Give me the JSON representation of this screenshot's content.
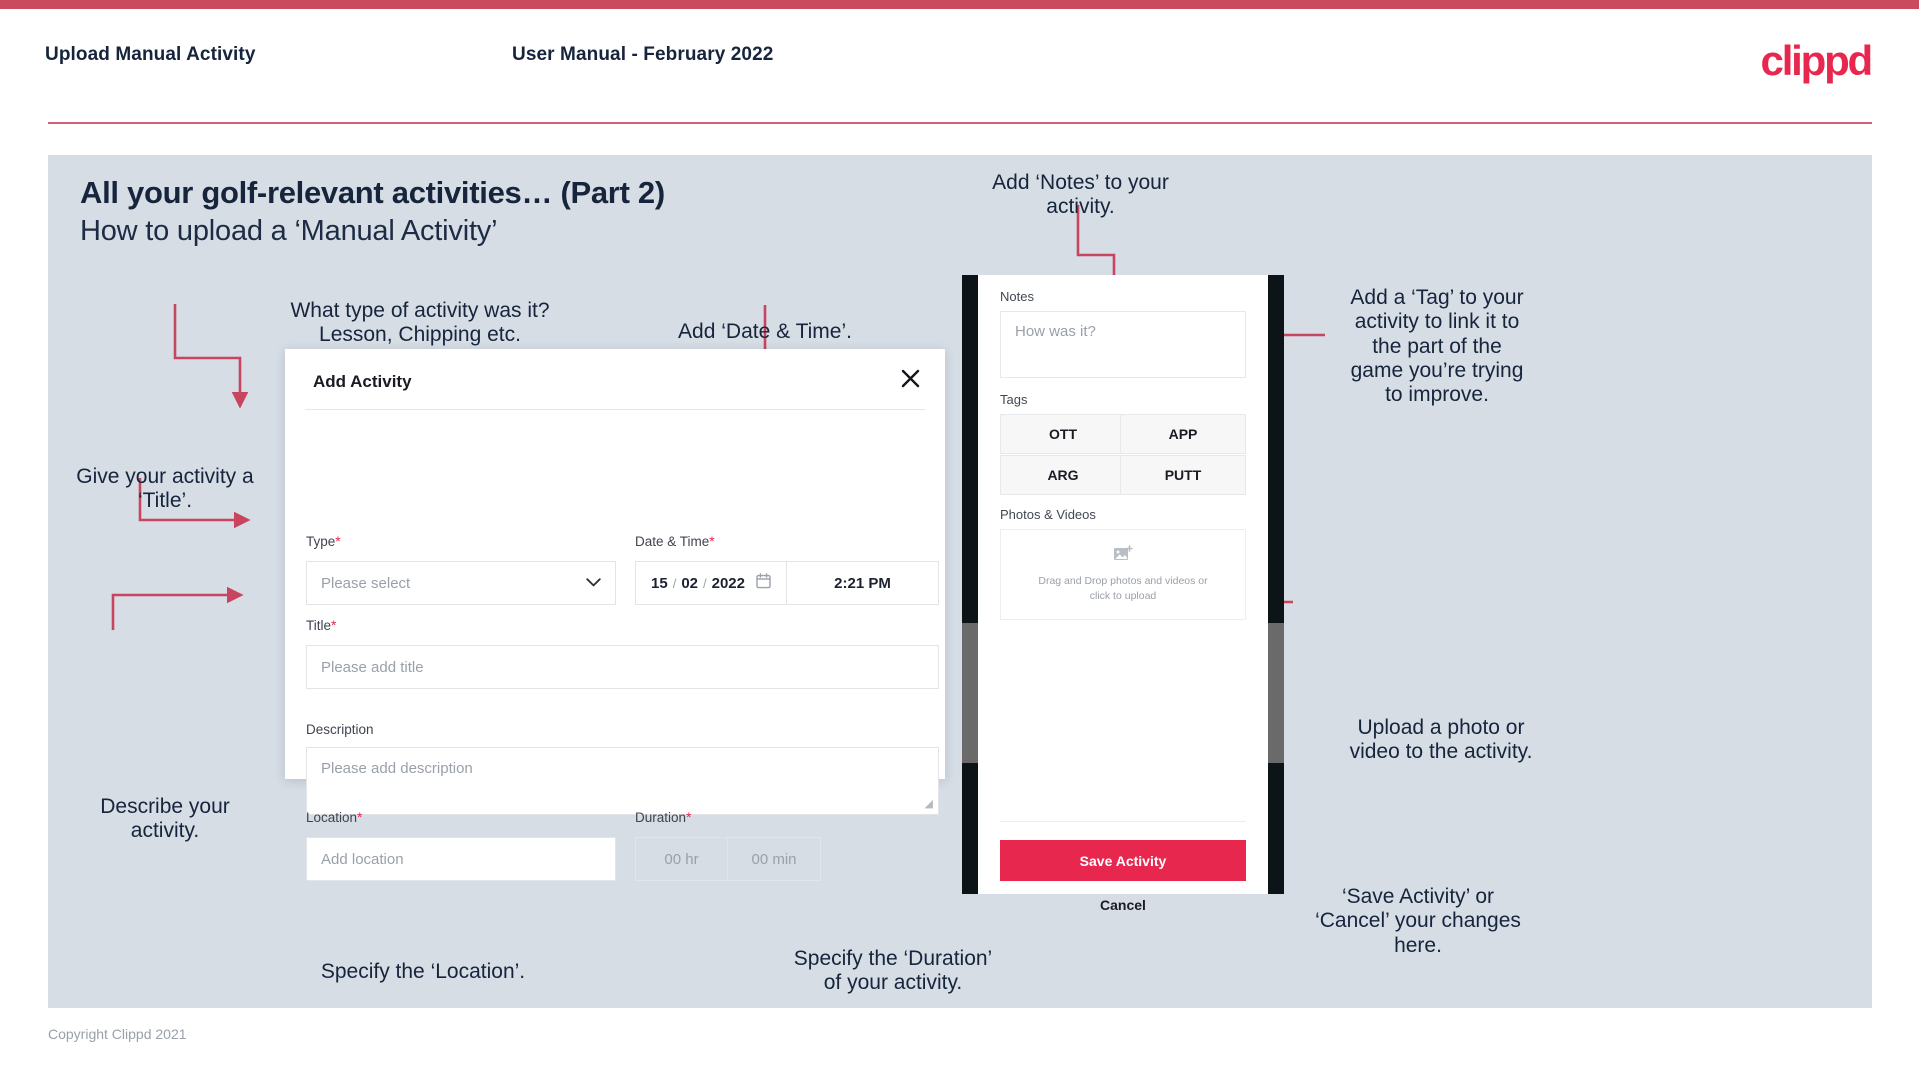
{
  "header": {
    "left_title": "Upload Manual Activity",
    "center_title": "User Manual - February 2022",
    "logo_text": "clippd"
  },
  "slide": {
    "heading": "All your golf-relevant activities… (Part 2)",
    "subheading": "How to upload a ‘Manual Activity’"
  },
  "annotations": {
    "type": "What type of activity was it?\nLesson, Chipping etc.",
    "datetime": "Add ‘Date & Time’.",
    "title": "Give your activity a\n‘Title’.",
    "description": "Describe your\nactivity.",
    "location": "Specify the ‘Location’.",
    "duration": "Specify the ‘Duration’\nof your activity.",
    "notes": "Add ‘Notes’ to your\nactivity.",
    "tags": "Add a ‘Tag’ to your\nactivity to link it to\nthe part of the\ngame you’re trying\nto improve.",
    "upload": "Upload a photo or\nvideo to the activity.",
    "save_cancel": "‘Save Activity’ or\n‘Cancel’ your changes\nhere."
  },
  "dialog": {
    "title": "Add Activity",
    "close_icon": "close-icon",
    "fields": {
      "type": {
        "label": "Type",
        "required": "*",
        "placeholder": "Please select",
        "chevron_icon": "chevron-down-icon"
      },
      "datetime": {
        "label": "Date & Time",
        "required": "*",
        "day": "15",
        "month": "02",
        "year": "2022",
        "separator": "/",
        "calendar_icon": "calendar-icon",
        "time": "2:21 PM"
      },
      "title": {
        "label": "Title",
        "required": "*",
        "placeholder": "Please add title"
      },
      "description": {
        "label": "Description",
        "required": "",
        "placeholder": "Please add description"
      },
      "location": {
        "label": "Location",
        "required": "*",
        "placeholder": "Add location"
      },
      "duration": {
        "label": "Duration",
        "required": "*",
        "hours_placeholder": "00 hr",
        "minutes_placeholder": "00 min"
      }
    }
  },
  "phone": {
    "notes": {
      "label": "Notes",
      "placeholder": "How was it?"
    },
    "tags": {
      "label": "Tags",
      "items": [
        "OTT",
        "APP",
        "ARG",
        "PUTT"
      ]
    },
    "photos": {
      "label": "Photos & Videos",
      "dropzone_icon": "add-image-icon",
      "dropzone_text_line1": "Drag and Drop photos and videos or",
      "dropzone_text_line2": "click to upload"
    },
    "save_label": "Save Activity",
    "cancel_label": "Cancel"
  },
  "footer": {
    "copyright": "Copyright Clippd 2021"
  },
  "colors": {
    "accent_pink": "#e8274f",
    "top_bar": "#cb4a5e",
    "leader_line": "#c9455f",
    "slide_bg": "#d6dde5",
    "text_dark": "#16243c"
  }
}
